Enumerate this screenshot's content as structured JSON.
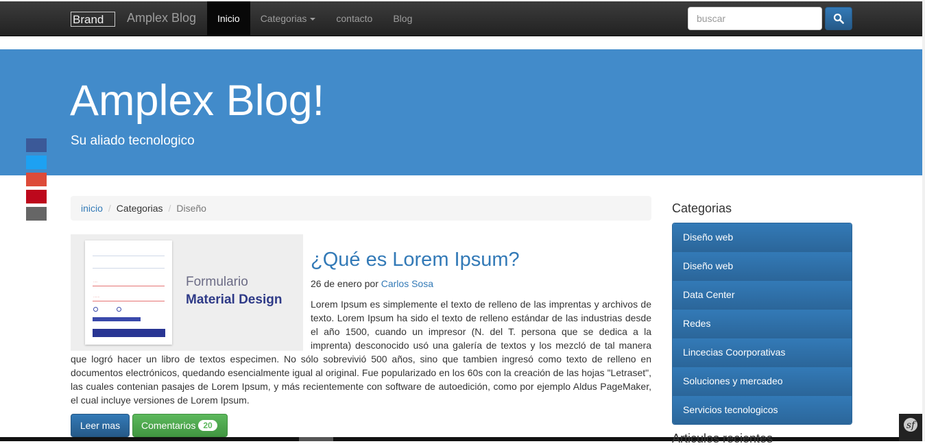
{
  "navbar": {
    "brand_alt": "Brand",
    "brand_text": "Amplex Blog",
    "items": [
      {
        "label": "Inicio",
        "active": true
      },
      {
        "label": "Categorias",
        "dropdown": true
      },
      {
        "label": "contacto"
      },
      {
        "label": "Blog"
      }
    ],
    "search_placeholder": "buscar",
    "search_icon": "search-icon"
  },
  "jumbotron": {
    "title": "Amplex Blog!",
    "subtitle": "Su aliado tecnologico"
  },
  "social": [
    {
      "name": "facebook",
      "color": "#3b5998"
    },
    {
      "name": "twitter",
      "color": "#1da1f2"
    },
    {
      "name": "google-plus",
      "color": "#dd4b39"
    },
    {
      "name": "pinterest",
      "color": "#bd081c"
    },
    {
      "name": "more",
      "color": "#666666"
    }
  ],
  "breadcrumb": {
    "items": [
      "inicio",
      "Categorias",
      "Diseño"
    ]
  },
  "article": {
    "image_text_line1": "Formulario",
    "image_text_line2": "Material Design",
    "title": "¿Qué es Lorem Ipsum?",
    "date": "26 de enero por",
    "author": "Carlos Sosa",
    "body": "Lorem Ipsum es simplemente el texto de relleno de las imprentas y archivos de texto. Lorem Ipsum ha sido el texto de relleno estándar de las industrias desde el año 1500, cuando un impresor (N. del T. persona que se dedica a la imprenta) desconocido usó una galería de textos y los mezcló de tal manera que logró hacer un libro de textos especimen. No sólo sobrevivió 500 años, sino que tambien ingresó como texto de relleno en documentos electrónicos, quedando esencialmente igual al original. Fue popularizado en los 60s con la creación de las hojas \"Letraset\", las cuales contenian pasajes de Lorem Ipsum, y más recientemente con software de autoedición, como por ejemplo Aldus PageMaker, el cual incluye versiones de Lorem Ipsum.",
    "read_more": "Leer mas",
    "comments_label": "Comentarios",
    "comments_count": "20"
  },
  "sidebar": {
    "title": "Categorias",
    "items": [
      "Diseño web",
      "Diseño web",
      "Data Center",
      "Redes",
      "Lincecias Coorporativas",
      "Soluciones y mercadeo",
      "Servicios tecnologicos"
    ],
    "next_title": "Articulos recientes"
  }
}
